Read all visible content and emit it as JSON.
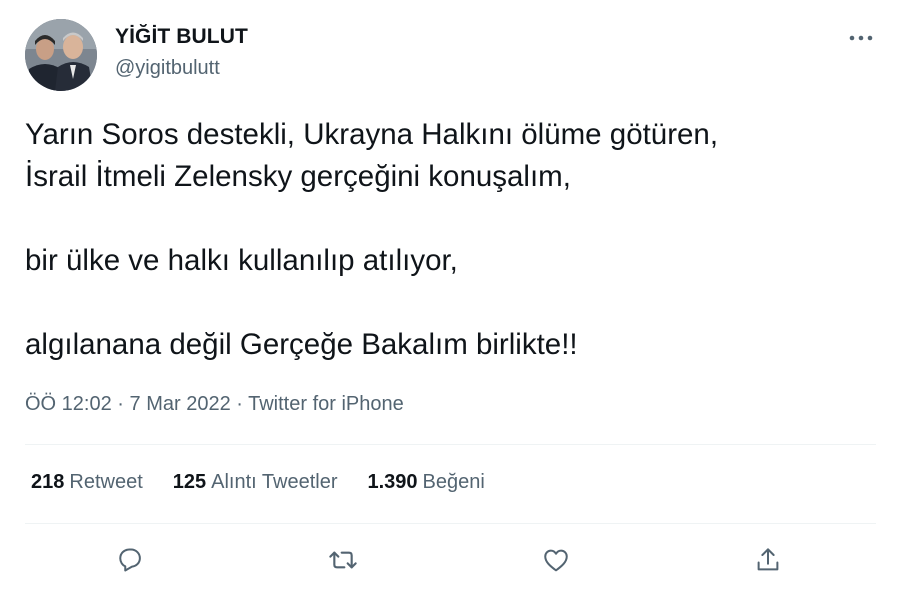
{
  "author": {
    "name": "YİĞİT BULUT",
    "handle": "@yigitbulutt"
  },
  "tweet": {
    "lines": [
      "Yarın Soros destekli, Ukrayna Halkını ölüme götüren,",
      "İsrail İtmeli Zelensky gerçeğini konuşalım,",
      "bir ülke ve halkı kullanılıp atılıyor,",
      "algılanana değil Gerçeğe Bakalım birlikte!!"
    ],
    "time": "ÖÖ 12:02",
    "date": "7 Mar 2022",
    "source": "Twitter for iPhone",
    "separator": "·"
  },
  "stats": {
    "retweets": {
      "count": "218",
      "label": "Retweet"
    },
    "quotes": {
      "count": "125",
      "label": "Alıntı Tweetler"
    },
    "likes": {
      "count": "1.390",
      "label": "Beğeni"
    }
  },
  "icons": {
    "more": "more-options-icon",
    "reply": "reply-icon",
    "retweet": "retweet-icon",
    "like": "like-icon",
    "share": "share-icon"
  },
  "colors": {
    "text": "#0f1419",
    "secondary": "#536471",
    "divider": "#eff3f4"
  }
}
